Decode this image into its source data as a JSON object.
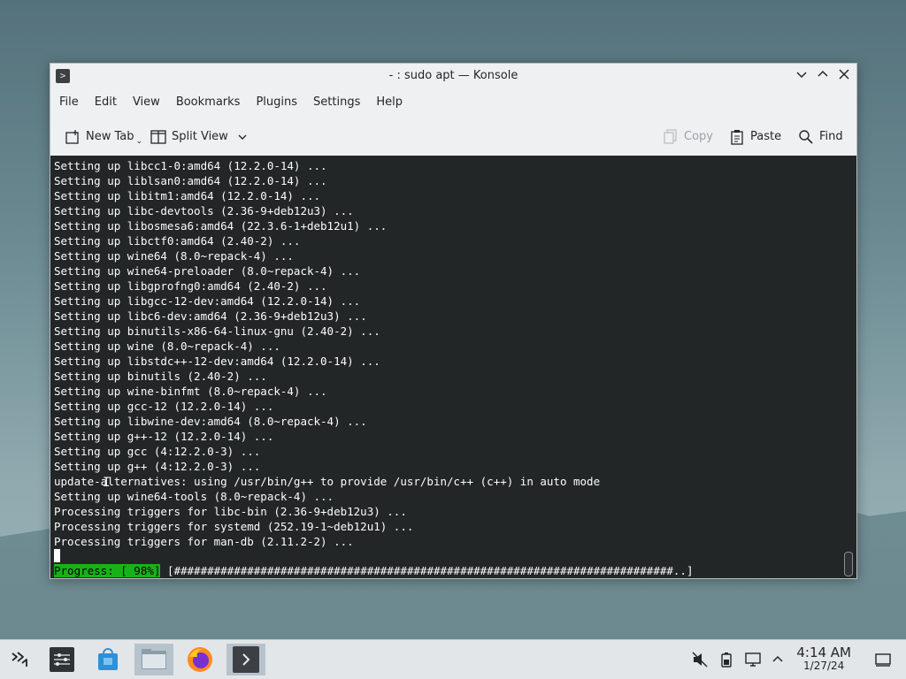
{
  "window": {
    "title": "- : sudo apt — Konsole",
    "app_icon": "terminal-prompt-icon"
  },
  "menu": [
    "File",
    "Edit",
    "View",
    "Bookmarks",
    "Plugins",
    "Settings",
    "Help"
  ],
  "toolbar": {
    "new_tab": "New Tab",
    "split_view": "Split View",
    "copy": "Copy",
    "paste": "Paste",
    "find": "Find"
  },
  "terminal": {
    "lines": [
      "Setting up libcc1-0:amd64 (12.2.0-14) ...",
      "Setting up liblsan0:amd64 (12.2.0-14) ...",
      "Setting up libitm1:amd64 (12.2.0-14) ...",
      "Setting up libc-devtools (2.36-9+deb12u3) ...",
      "Setting up libosmesa6:amd64 (22.3.6-1+deb12u1) ...",
      "Setting up libctf0:amd64 (2.40-2) ...",
      "Setting up wine64 (8.0~repack-4) ...",
      "Setting up wine64-preloader (8.0~repack-4) ...",
      "Setting up libgprofng0:amd64 (2.40-2) ...",
      "Setting up libgcc-12-dev:amd64 (12.2.0-14) ...",
      "Setting up libc6-dev:amd64 (2.36-9+deb12u3) ...",
      "Setting up binutils-x86-64-linux-gnu (2.40-2) ...",
      "Setting up wine (8.0~repack-4) ...",
      "Setting up libstdc++-12-dev:amd64 (12.2.0-14) ...",
      "Setting up binutils (2.40-2) ...",
      "Setting up wine-binfmt (8.0~repack-4) ...",
      "Setting up gcc-12 (12.2.0-14) ...",
      "Setting up libwine-dev:amd64 (8.0~repack-4) ...",
      "Setting up g++-12 (12.2.0-14) ...",
      "Setting up gcc (4:12.2.0-3) ...",
      "Setting up g++ (4:12.2.0-3) ...",
      "update-alternatives: using /usr/bin/g++ to provide /usr/bin/c++ (c++) in auto mode",
      "Setting up wine64-tools (8.0~repack-4) ...",
      "Processing triggers for libc-bin (2.36-9+deb12u3) ...",
      "Processing triggers for systemd (252.19-1~deb12u1) ...",
      "Processing triggers for man-db (2.11.2-2) ..."
    ],
    "progress_label": "Progress: [ 98%]",
    "progress_bar": " [###########################################################################..]",
    "progress_percent": 98
  },
  "taskbar": {
    "apps": [
      "app-launcher-icon",
      "system-settings-icon",
      "discover-icon",
      "dolphin-files-icon",
      "firefox-icon",
      "konsole-icon"
    ],
    "tray": [
      "volume-muted-icon",
      "battery-icon",
      "network-icon",
      "tray-expand-icon"
    ],
    "time": "4:14 AM",
    "date": "1/27/24"
  }
}
